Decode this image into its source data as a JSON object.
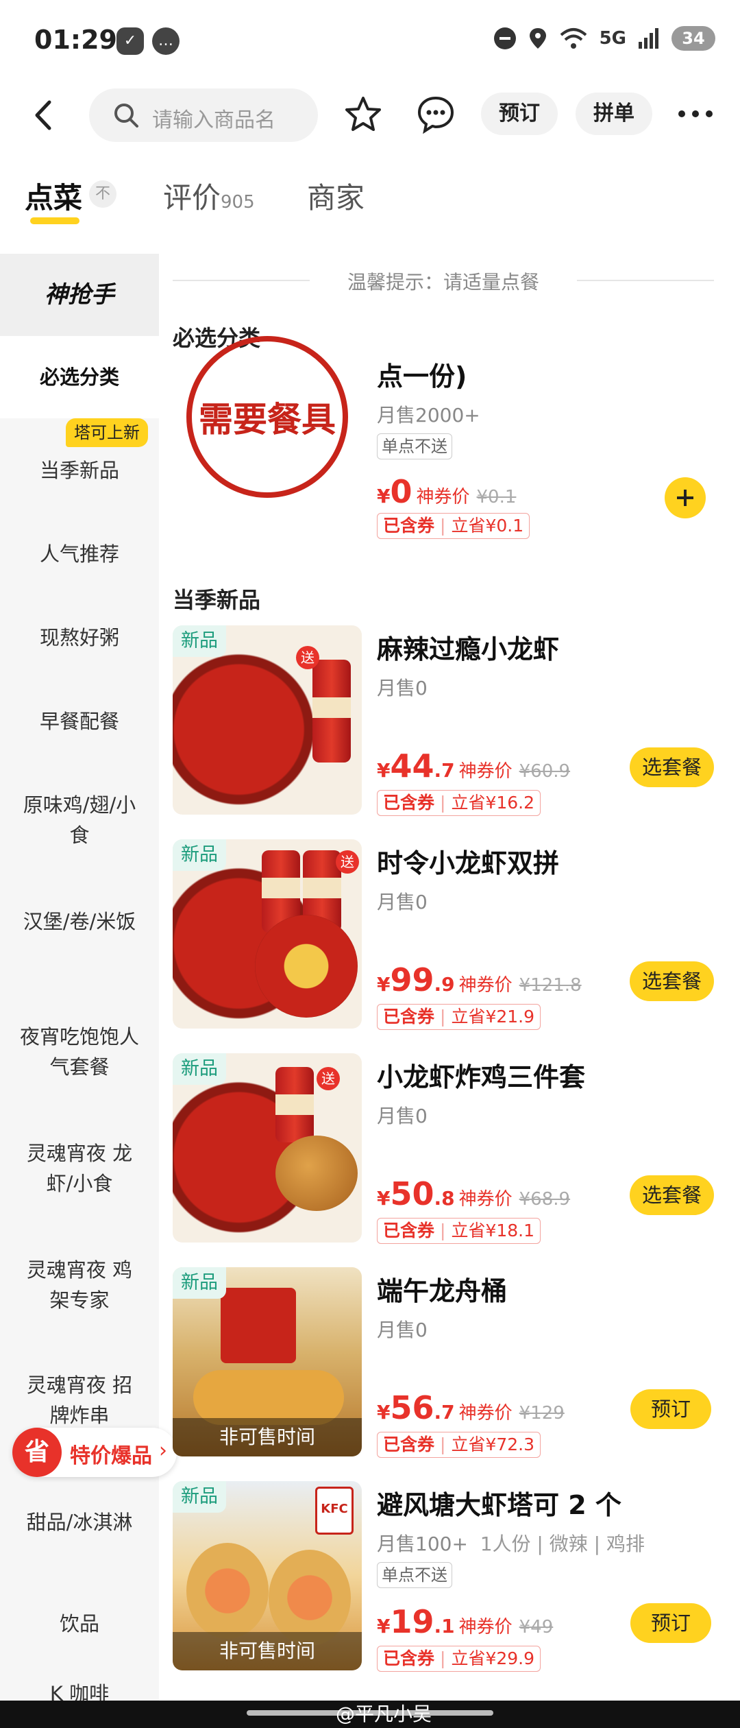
{
  "status": {
    "time": "01:29",
    "battery": "34",
    "signal": "5G"
  },
  "header": {
    "search_placeholder": "请输入商品名",
    "reserve_label": "预订",
    "group_label": "拼单"
  },
  "tabs": [
    {
      "label": "点菜",
      "badge": "不"
    },
    {
      "label": "评价",
      "count": "905"
    },
    {
      "label": "商家"
    }
  ],
  "sidebar": {
    "logo": "神抢手",
    "badge": "塔可上新",
    "items": [
      "必选分类",
      "当季新品",
      "人气推荐",
      "现熬好粥",
      "早餐配餐",
      "原味鸡/翅/小食",
      "汉堡/卷/米饭",
      "夜宵吃饱饱人气套餐",
      "灵魂宵夜 龙虾/小食",
      "灵魂宵夜 鸡架专家",
      "灵魂宵夜 招牌炸串",
      "甜品/冰淇淋",
      "饮品",
      "K 咖啡"
    ],
    "promo_icon": "省",
    "promo_label": "特价爆品"
  },
  "main": {
    "notice": "温馨提示：请适量点餐",
    "section_required": "必选分类",
    "section_new": "当季新品",
    "required_item": {
      "name_tail": "点一份)",
      "image_text": "需要餐具",
      "sales": "月售2000+",
      "tag": "单点不送",
      "price_int": "0",
      "price_label": "神券价",
      "orig": "¥0.1",
      "coupon_a": "已含券",
      "coupon_b": "立省¥0.1"
    },
    "items": [
      {
        "new": "新品",
        "name": "麻辣过瘾小龙虾",
        "sales": "月售0",
        "price_int": "44",
        "price_dec": ".7",
        "price_label": "神券价",
        "orig": "¥60.9",
        "coupon_a": "已含券",
        "coupon_b": "立省¥16.2",
        "action": "选套餐",
        "send": "送"
      },
      {
        "new": "新品",
        "name": "时令小龙虾双拼",
        "sales": "月售0",
        "price_int": "99",
        "price_dec": ".9",
        "price_label": "神券价",
        "orig": "¥121.8",
        "coupon_a": "已含券",
        "coupon_b": "立省¥21.9",
        "action": "选套餐",
        "send": "送"
      },
      {
        "new": "新品",
        "name": "小龙虾炸鸡三件套",
        "sales": "月售0",
        "price_int": "50",
        "price_dec": ".8",
        "price_label": "神券价",
        "orig": "¥68.9",
        "coupon_a": "已含券",
        "coupon_b": "立省¥18.1",
        "action": "选套餐",
        "send": "送"
      },
      {
        "new": "新品",
        "name": "端午龙舟桶",
        "sales": "月售0",
        "price_int": "56",
        "price_dec": ".7",
        "price_label": "神券价",
        "orig": "¥129",
        "coupon_a": "已含券",
        "coupon_b": "立省¥72.3",
        "action": "预订",
        "blockout": "非可售时间"
      },
      {
        "new": "新品",
        "name": "避风塘大虾塔可 2 个",
        "sales": "月售100+",
        "sales_extra": "1人份 | 微辣 | 鸡排",
        "tag": "单点不送",
        "price_int": "19",
        "price_dec": ".1",
        "price_label": "神券价",
        "orig": "¥49",
        "coupon_a": "已含券",
        "coupon_b": "立省¥29.9",
        "action": "预订",
        "blockout": "非可售时间",
        "logo": "KFC"
      }
    ]
  },
  "watermark": "@平凡小吴",
  "colors": {
    "accent": "#ffd21f",
    "price": "#e8322a",
    "new_tag": "#1c9c7c"
  }
}
